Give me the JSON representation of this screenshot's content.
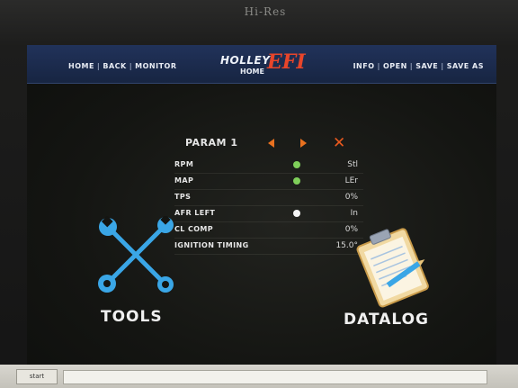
{
  "bezel": {
    "brand": "Hi-Res"
  },
  "header": {
    "nav_left": [
      "HOME",
      "BACK",
      "MONITOR"
    ],
    "logo_word": "HOLLEY",
    "logo_efi": "EFI",
    "subtitle": "HOME",
    "nav_right": [
      "INFO",
      "OPEN",
      "SAVE",
      "SAVE AS"
    ]
  },
  "param": {
    "title": "PARAM 1",
    "rows": [
      {
        "label": "RPM",
        "dot": "green",
        "value": "Stl"
      },
      {
        "label": "MAP",
        "dot": "green",
        "value": "LEr"
      },
      {
        "label": "TPS",
        "dot": "",
        "value": "0%"
      },
      {
        "label": "AFR LEFT",
        "dot": "white",
        "value": "In"
      },
      {
        "label": "CL COMP",
        "dot": "",
        "value": "0%"
      },
      {
        "label": "IGNITION TIMING",
        "dot": "",
        "value": "15.0°"
      }
    ]
  },
  "tools": {
    "label": "TOOLS",
    "icon": "wrench-icon"
  },
  "datalog": {
    "label": "DATALOG",
    "icon": "clipboard-icon"
  },
  "colors": {
    "accent_orange": "#e8711f",
    "efi_red": "#e8452a",
    "dot_green": "#7fcf5a",
    "dot_white": "#f4f4f4",
    "icon_blue": "#3aa6e6"
  },
  "taskbar": {
    "start_label": "start"
  }
}
